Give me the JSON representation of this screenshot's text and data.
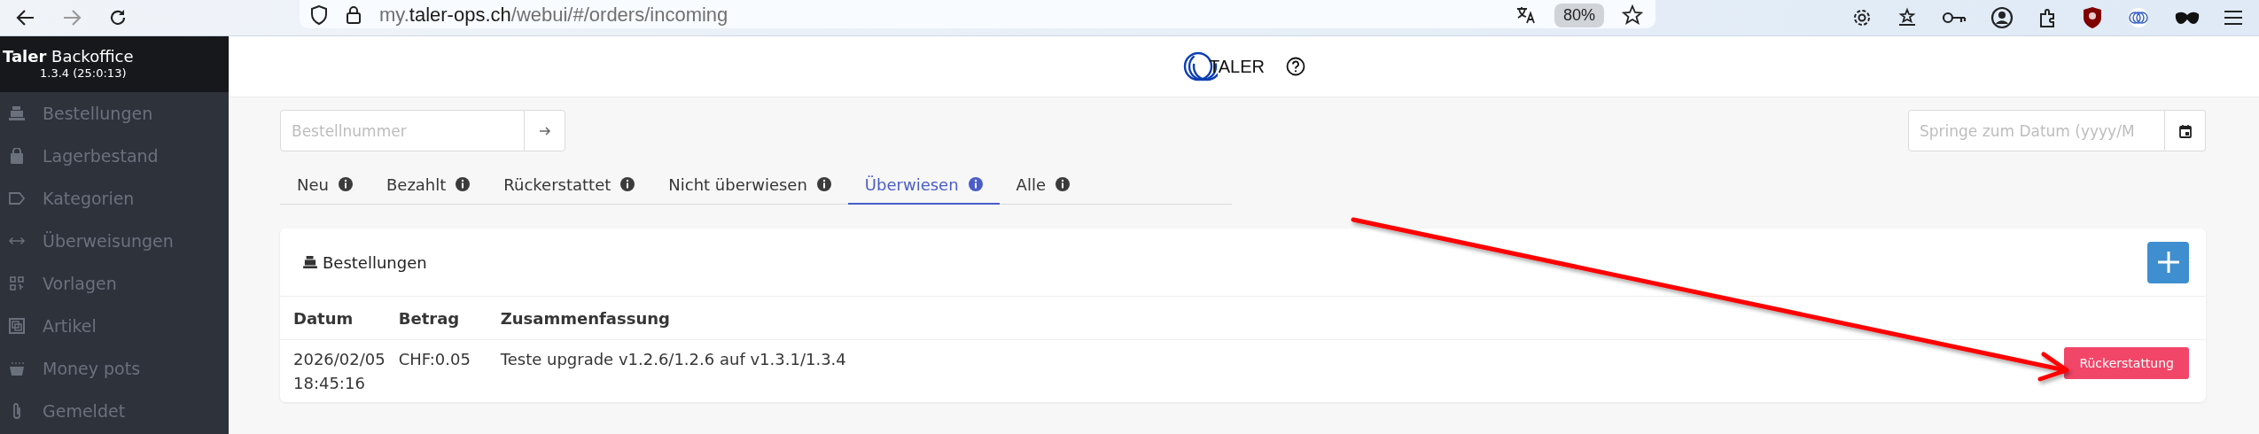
{
  "browser": {
    "url_parts": [
      {
        "text": "my.",
        "highlighted": false
      },
      {
        "text": "taler-ops.ch",
        "highlighted": true
      },
      {
        "text": "/webui/#/orders/incoming",
        "highlighted": false
      }
    ],
    "zoom": "80%"
  },
  "sidebar": {
    "title": "**Taler** Backoffice",
    "version": "1.3.4 (25:0:13)",
    "items": [
      {
        "label": "Bestellungen"
      },
      {
        "label": "Lagerbestand"
      },
      {
        "label": "Kategorien"
      },
      {
        "label": "Überweisungen"
      },
      {
        "label": "Vorlagen"
      },
      {
        "label": "Artikel"
      },
      {
        "label": "Money pots"
      },
      {
        "label": "Gemeldet"
      }
    ]
  },
  "header": {
    "logo_text": "TALER"
  },
  "order_search": {
    "placeholder": "Bestellnummer"
  },
  "date_search": {
    "placeholder": "Springe zum Datum (yyyy/M"
  },
  "tabs": [
    {
      "label": "Neu",
      "selected": false
    },
    {
      "label": "Bezahlt",
      "selected": false
    },
    {
      "label": "Rückerstattet",
      "selected": false
    },
    {
      "label": "Nicht überwiesen",
      "selected": false
    },
    {
      "label": "Überwiesen",
      "selected": true
    },
    {
      "label": "Alle",
      "selected": false
    }
  ],
  "orders_card": {
    "title": "Bestellungen",
    "columns": [
      "Datum",
      "Betrag",
      "Zusammenfassung"
    ],
    "rows": [
      {
        "cells": [
          "2026/02/05 18:45:16",
          "CHF:0.05",
          "Teste upgrade v1.2.6/1.2.6 auf v1.3.1/1.3.4"
        ],
        "action": "Rückerstattung"
      }
    ]
  }
}
